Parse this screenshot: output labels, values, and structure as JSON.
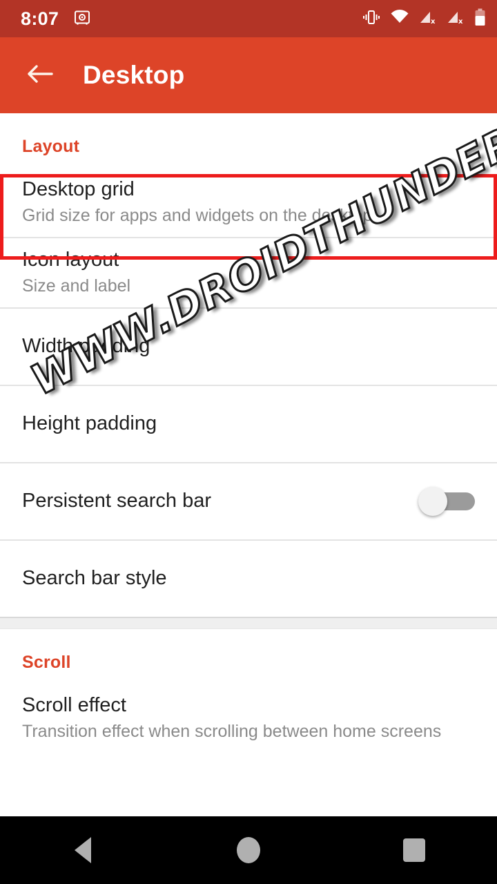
{
  "statusbar": {
    "time": "8:07",
    "icons_left": [
      "screenshot-safe-icon"
    ],
    "icons_right": [
      "vibrate-icon",
      "wifi-icon",
      "cellular-no-sim-1-icon",
      "cellular-no-sim-2-icon",
      "battery-icon"
    ],
    "background_color": "#b33426",
    "foreground_color": "#ffffff"
  },
  "appbar": {
    "back_label": "back-arrow",
    "title": "Desktop",
    "background_color": "#dd4428",
    "title_color": "#ffffff"
  },
  "annotation": {
    "color": "#ed1c1c",
    "target": "Desktop grid"
  },
  "watermark": {
    "text": "WWW.DROIDTHUNDER.COM"
  },
  "sections": [
    {
      "header": "Layout",
      "header_color": "#dd4428",
      "rows": [
        {
          "title": "Desktop grid",
          "subtitle": "Grid size for apps and widgets on the desktop",
          "control": "none",
          "highlighted": true
        },
        {
          "title": "Icon layout",
          "subtitle": "Size and label",
          "control": "none",
          "highlighted": false
        },
        {
          "title": "Width padding",
          "subtitle": "",
          "control": "none",
          "highlighted": false
        },
        {
          "title": "Height padding",
          "subtitle": "",
          "control": "none",
          "highlighted": false
        },
        {
          "title": "Persistent search bar",
          "subtitle": "",
          "control": "toggle",
          "toggle_state": "off",
          "highlighted": false
        },
        {
          "title": "Search bar style",
          "subtitle": "",
          "control": "none",
          "highlighted": false
        }
      ]
    },
    {
      "header": "Scroll",
      "header_color": "#dd4428",
      "rows": [
        {
          "title": "Scroll effect",
          "subtitle": "Transition effect when scrolling between home screens",
          "control": "none",
          "highlighted": false
        }
      ]
    }
  ],
  "navbar": {
    "buttons": [
      "back-triangle-icon",
      "home-circle-icon",
      "recents-square-icon"
    ],
    "background_color": "#000000",
    "icon_color": "#b0b0b0"
  }
}
